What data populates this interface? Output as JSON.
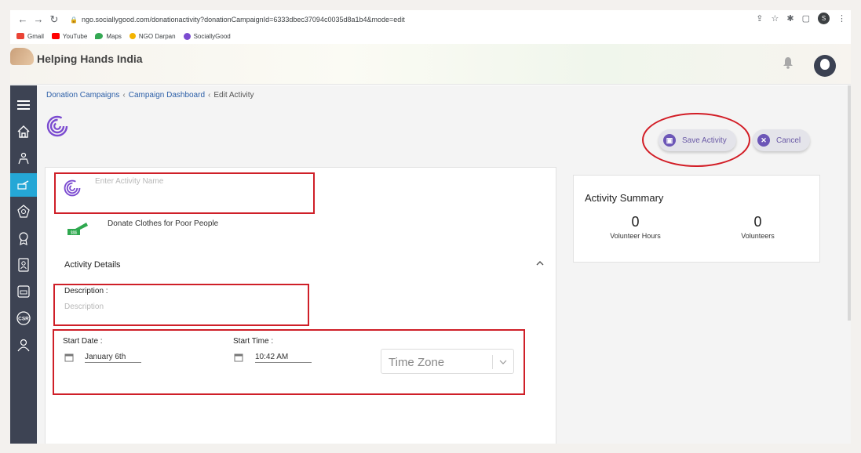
{
  "browser": {
    "url": "ngo.sociallygood.com/donationactivity?donationCampaignId=6333dbec37094c0035d8a1b4&mode=edit",
    "profile_initial": "S",
    "bookmarks": [
      {
        "label": "Gmail",
        "color": "#ea4335"
      },
      {
        "label": "YouTube",
        "color": "#ff0000"
      },
      {
        "label": "Maps",
        "color": "#34a853"
      },
      {
        "label": "NGO Darpan",
        "color": "#f4b400"
      },
      {
        "label": "SociallyGood",
        "color": "#7b4bd0"
      }
    ]
  },
  "app": {
    "brand": "Helping Hands India"
  },
  "breadcrumbs": [
    {
      "label": "Donation Campaigns"
    },
    {
      "label": "Campaign Dashboard"
    },
    {
      "label": "Edit Activity"
    }
  ],
  "actions": {
    "save_label": "Save Activity",
    "cancel_label": "Cancel"
  },
  "form": {
    "name_placeholder": "Enter Activity Name",
    "campaign_name": "Donate Clothes for Poor People",
    "details_title": "Activity Details",
    "description_label": "Description :",
    "description_placeholder": "Description",
    "start_date_label": "Start Date :",
    "start_date_value": "January 6th",
    "start_time_label": "Start Time :",
    "start_time_value": "10:42 AM",
    "timezone_placeholder": "Time Zone"
  },
  "summary": {
    "title": "Activity Summary",
    "volunteer_hours_value": "0",
    "volunteer_hours_label": "Volunteer Hours",
    "volunteers_value": "0",
    "volunteers_label": "Volunteers"
  },
  "colors": {
    "accent": "#6c56b7",
    "link": "#2c5fa8",
    "sidebar": "#3d4353",
    "sidebar_active": "#25a7d6",
    "highlight": "#cf1f28"
  }
}
